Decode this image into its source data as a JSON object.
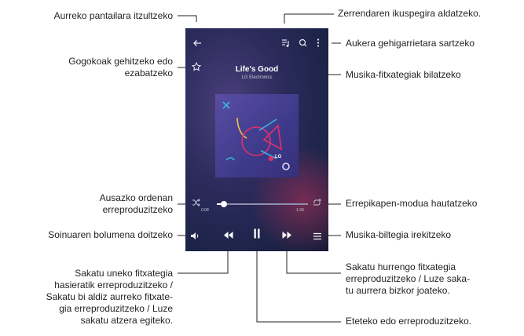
{
  "callouts": {
    "back": "Aurreko pantailara itzultzeko",
    "favorite": "Gogokoak gehitzeko edo\nezabatzeko",
    "shuffle": "Ausazko ordenan\nerreproduzitzeko",
    "volume": "Soinuaren bolumena doitzeko",
    "previous": "Sakatu uneko fitxategia\nhasieratik erreproduzitzeko /\nSakatu bi aldiz aurreko fitxate-\ngia erreproduzitzeko / Luze\nsakatu atzera egiteko.",
    "list_view": "Zerrendaren ikuspegira aldatzeko.",
    "more_options": "Aukera gehigarrietara sartzeko",
    "search": "Musika-fitxategiak bilatzeko",
    "repeat": "Errepikapen-modua hautatzeko",
    "library": "Musika-biltegia irekitzeko",
    "next": "Sakatu hurrengo fitxategia\nerreproduzitzeko / Luze saka-\ntu aurrera bizkor joateko.",
    "pause": "Eteteko edo erreproduzitzeko."
  },
  "player": {
    "song_title": "Life's Good",
    "artist": "LG Electronics",
    "elapsed": "0:08",
    "duration": "1:39",
    "progress_fraction": 0.08,
    "album_logo_text": "LG",
    "icons": {
      "back": "arrow-left-icon",
      "favorite": "star-icon",
      "list_view": "playlist-icon",
      "search": "search-icon",
      "more": "more-vertical-icon",
      "shuffle": "shuffle-icon",
      "repeat": "repeat-icon",
      "volume": "speaker-icon",
      "previous": "skip-previous-icon",
      "pause": "pause-icon",
      "next": "skip-next-icon",
      "library": "menu-icon"
    }
  },
  "colors": {
    "screen_bg": "#24264f",
    "album_bg": "#4a3f97",
    "accent_pink": "#e0306a",
    "accent_cyan": "#39b7e0",
    "callout_line": "#231f20"
  }
}
